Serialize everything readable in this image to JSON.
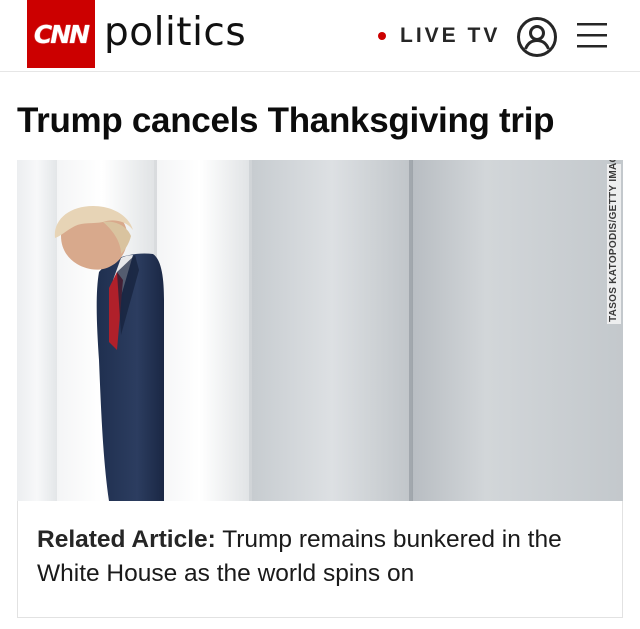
{
  "header": {
    "logo_text": "CNN",
    "section": "politics",
    "live_label": "LIVE TV",
    "brand_color": "#cc0000",
    "live_dot_color": "#cc0000",
    "account_icon": "user-circle-icon",
    "menu_icon": "hamburger-menu-icon"
  },
  "article": {
    "headline": "Trump cancels Thanksgiving trip",
    "image_credit": "TASOS KATOPODIS/GETTY IMAGES"
  },
  "related": {
    "label": "Related Article:",
    "title": "Trump remains bunkered in the White House as the world spins on"
  }
}
